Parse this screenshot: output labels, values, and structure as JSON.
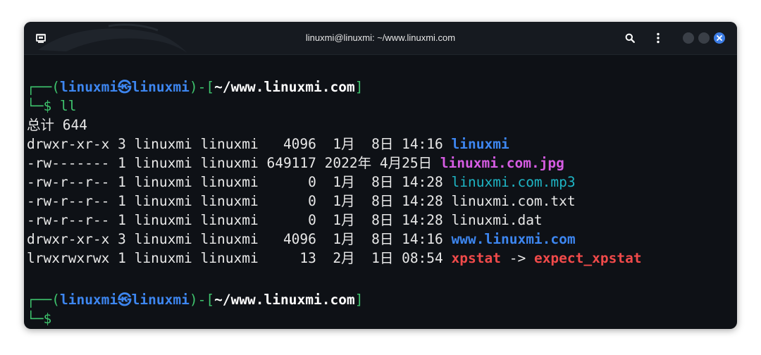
{
  "window": {
    "title": "linuxmi@linuxmi: ~/www.linuxmi.com"
  },
  "icons": {
    "terminal": "terminal-icon",
    "search": "search-icon",
    "menu": "kebab-menu-icon",
    "minimize": "minimize-dot",
    "maximize": "maximize-dot",
    "close": "close-icon"
  },
  "colors": {
    "background": "#0e1116",
    "prompt_frame": "#3ec46d",
    "user_host": "#3d86f0",
    "directory": "#3d86f0",
    "image_file": "#d65ce3",
    "media_file": "#1eb5c4",
    "symlink": "#f04a4a"
  },
  "terminal": {
    "prompt1": {
      "frame_open": "┌──(",
      "user": "linuxmi",
      "at": "㉿",
      "host": "linuxmi",
      "frame_mid": ")-[",
      "path": "~/www.linuxmi.com",
      "frame_close": "]",
      "cmd_prefix": "└─$",
      "command": " ll"
    },
    "total": "总计 644",
    "rows": [
      {
        "meta": "drwxr-xr-x 3 linuxmi linuxmi   4096  1月  8日 14:16 ",
        "name": "linuxmi"
      },
      {
        "meta": "-rw------- 1 linuxmi linuxmi 649117 2022年 4月25日 ",
        "name": "linuxmi.com.jpg"
      },
      {
        "meta": "-rw-r--r-- 1 linuxmi linuxmi      0  1月  8日 14:28 ",
        "name": "linuxmi.com.mp3"
      },
      {
        "meta": "-rw-r--r-- 1 linuxmi linuxmi      0  1月  8日 14:28 ",
        "name": "linuxmi.com.txt"
      },
      {
        "meta": "-rw-r--r-- 1 linuxmi linuxmi      0  1月  8日 14:28 ",
        "name": "linuxmi.dat"
      },
      {
        "meta": "drwxr-xr-x 3 linuxmi linuxmi   4096  1月  8日 14:16 ",
        "name": "www.linuxmi.com"
      },
      {
        "meta": "lrwxrwxrwx 1 linuxmi linuxmi     13  2月  1日 08:54 ",
        "name": "xpstat",
        "arrow": " -> ",
        "target": "expect_xpstat"
      }
    ],
    "prompt2": {
      "frame_open": "┌──(",
      "user": "linuxmi",
      "at": "㉿",
      "host": "linuxmi",
      "frame_mid": ")-[",
      "path": "~/www.linuxmi.com",
      "frame_close": "]",
      "cmd_prefix": "└─$"
    }
  }
}
